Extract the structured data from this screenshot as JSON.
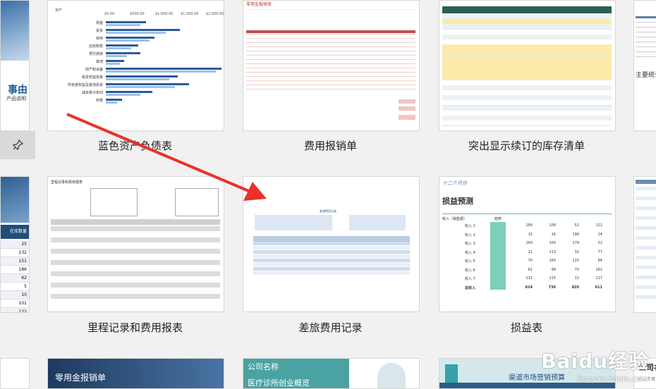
{
  "left_panel": {
    "title": "事由",
    "subtitle": "产品说明",
    "table_header": "在库数量",
    "values": [
      "25",
      "132",
      "151",
      "186",
      "62",
      "5",
      "10",
      "101",
      "122"
    ]
  },
  "templates": [
    {
      "label": "蓝色资产负债表"
    },
    {
      "label": "费用报销单"
    },
    {
      "label": "突出显示续订的库存清单"
    },
    {
      "label": "里程记录和费用报表"
    },
    {
      "label": "差旅费用记录"
    },
    {
      "label": "损益表"
    }
  ],
  "balance": {
    "title": "资产",
    "axis": [
      "$0.00",
      "$500.00",
      "$1,000.00",
      "$1,500.00",
      "$2,000.00"
    ],
    "rows": [
      {
        "name": "现金",
        "a": 0.35,
        "b": 0.3
      },
      {
        "name": "投资",
        "a": 0.64,
        "b": 0.52
      },
      {
        "name": "库存",
        "a": 0.42,
        "b": 0.38
      },
      {
        "name": "应收账款",
        "a": 0.28,
        "b": 0.22
      },
      {
        "name": "预付费用",
        "a": 0.3,
        "b": 0.18
      },
      {
        "name": "其他",
        "a": 0.16,
        "b": 0.12
      },
      {
        "name": "财产和设备",
        "a": 1.0,
        "b": 0.95
      },
      {
        "name": "租赁权益改良",
        "a": 0.62,
        "b": 0.55
      },
      {
        "name": "所有者权益及其他投资",
        "a": 0.72,
        "b": 0.6
      },
      {
        "name": "减去累计折旧",
        "a": 0.4,
        "b": 0.3
      },
      {
        "name": "商誉",
        "a": 0.14,
        "b": 0.1
      }
    ]
  },
  "expense": {
    "title": "零用金报销单"
  },
  "inventory": {
    "rows": 22
  },
  "mileage": {
    "title": "里程记录和费用报表"
  },
  "travel": {
    "title": "差旅费用记录"
  },
  "pnl": {
    "subtitle": "十二个月份",
    "title": "损益预测",
    "income_label": "收入（销售额）",
    "trend_label": "趋势",
    "rows": [
      {
        "name": "收入 1",
        "v": [
          "166",
          "108",
          "52",
          "122"
        ]
      },
      {
        "name": "收入 2",
        "v": [
          "15",
          "16",
          "198",
          "24"
        ]
      },
      {
        "name": "收入 3",
        "v": [
          "160",
          "105",
          "179",
          "52"
        ]
      },
      {
        "name": "收入 4",
        "v": [
          "21",
          "113",
          "32",
          "77"
        ]
      },
      {
        "name": "收入 5",
        "v": [
          "70",
          "160",
          "125",
          "84"
        ]
      },
      {
        "name": "收入 6",
        "v": [
          "61",
          "99",
          "70",
          "162"
        ]
      },
      {
        "name": "收入 7",
        "v": [
          "131",
          "115",
          "12",
          "117"
        ]
      }
    ],
    "total_label": "总收入",
    "totals": [
      "624",
      "736",
      "820",
      "611"
    ]
  },
  "bottom_row": [
    {
      "title": "零用金报销单"
    },
    {
      "title": "公司名称",
      "subtitle": "医疗诊所创业概览"
    },
    {
      "title": "渠道市场营销预算"
    },
    {
      "title": "公司名",
      "subtitle": "十二个月"
    }
  ],
  "right_partial": {
    "title": "主要统计"
  },
  "watermark": {
    "brand": "Baidu经验",
    "url": "jingyan.baidu.com"
  }
}
